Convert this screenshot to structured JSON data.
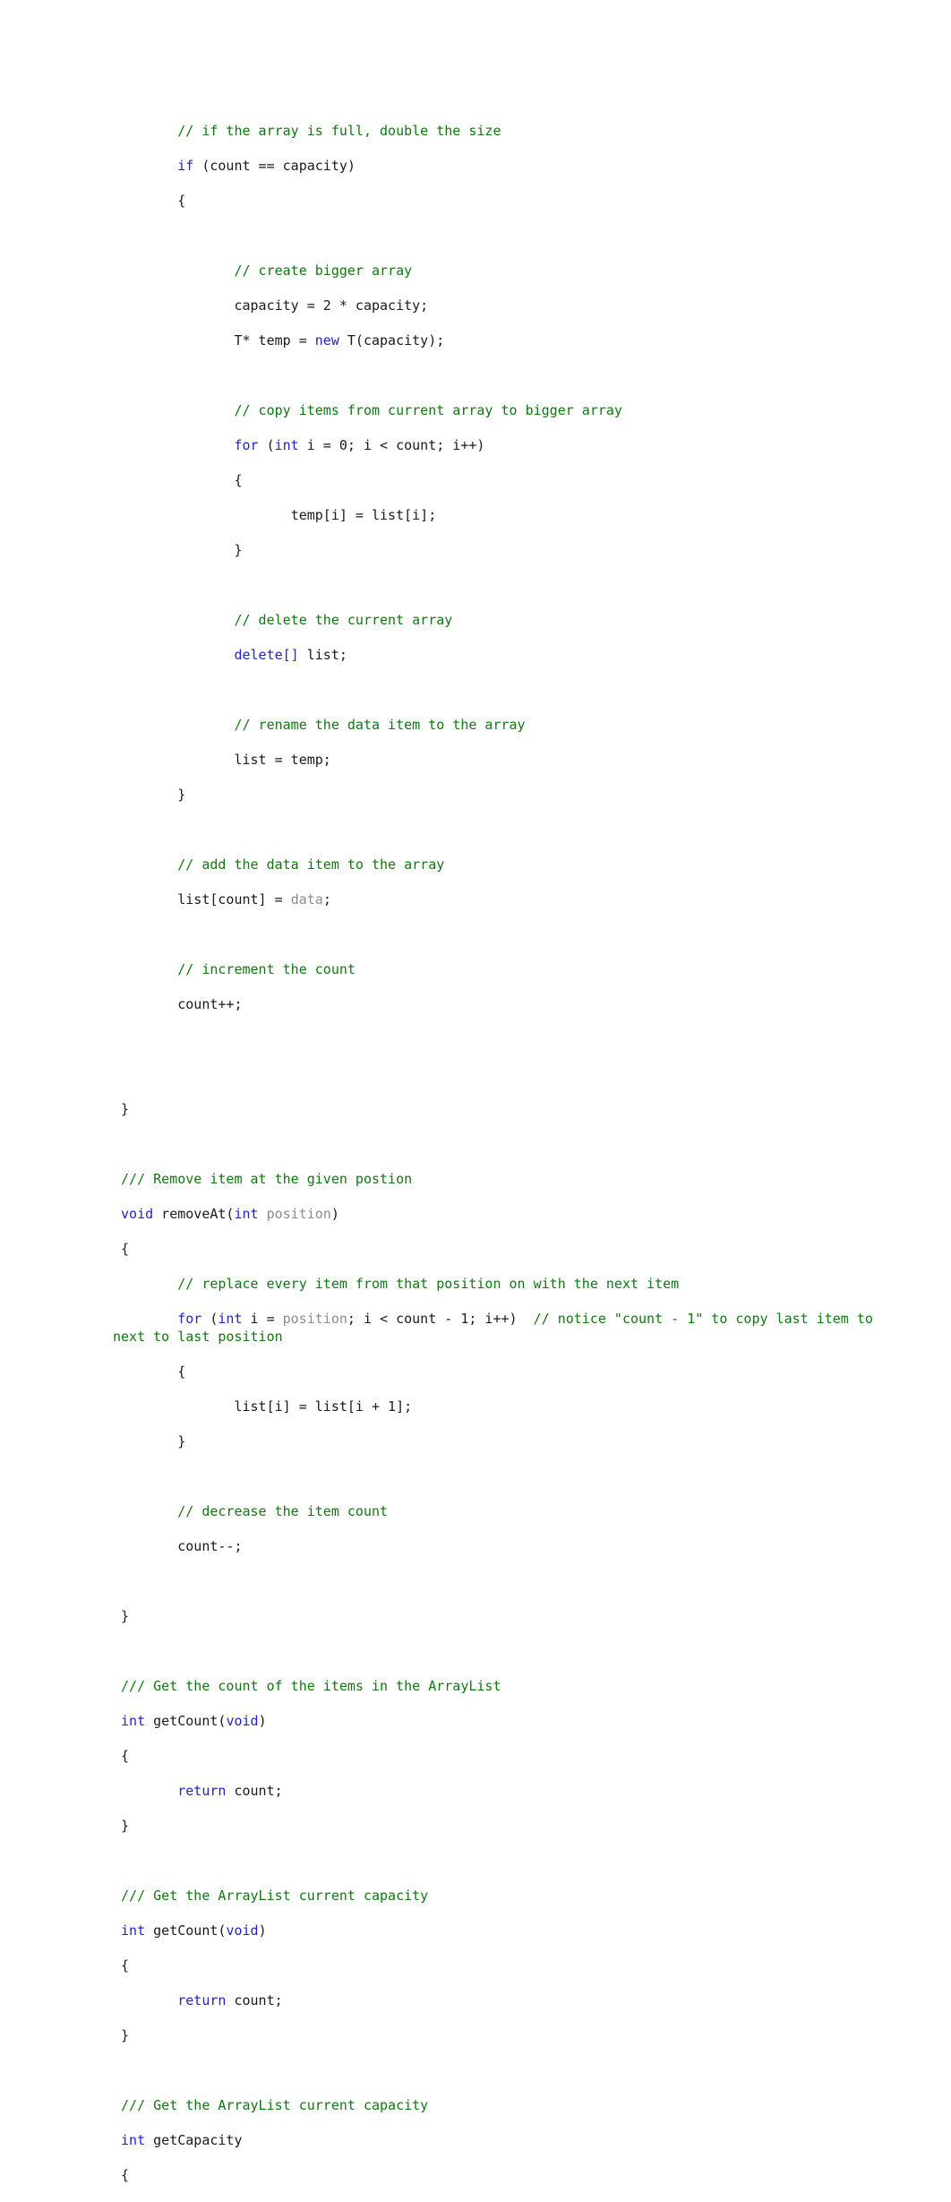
{
  "document": {
    "kind": "code-listing",
    "language": "C++",
    "page_background": "#ffffff",
    "colors": {
      "comment": "#117711",
      "keyword": "#2222cc",
      "plain": "#1a1a1a",
      "parameter": "#8c8c8c"
    }
  },
  "code": {
    "lines": [
      {
        "id": "l01",
        "indent": 8,
        "tokens": [
          {
            "t": "comment",
            "s": "// if the array is full, double the size"
          }
        ]
      },
      {
        "id": "l02",
        "indent": 8,
        "tokens": [
          {
            "t": "keyword",
            "s": "if"
          },
          {
            "t": "plain",
            "s": " (count == capacity)"
          }
        ]
      },
      {
        "id": "l03",
        "indent": 8,
        "tokens": [
          {
            "t": "plain",
            "s": "{"
          }
        ]
      },
      {
        "id": "l04",
        "indent": 8,
        "tokens": []
      },
      {
        "id": "l05",
        "indent": 15,
        "tokens": [
          {
            "t": "comment",
            "s": "// create bigger array"
          }
        ]
      },
      {
        "id": "l06",
        "indent": 15,
        "tokens": [
          {
            "t": "plain",
            "s": "capacity = 2 * capacity;"
          }
        ]
      },
      {
        "id": "l07",
        "indent": 15,
        "tokens": [
          {
            "t": "plain",
            "s": "T* temp = "
          },
          {
            "t": "keyword",
            "s": "new"
          },
          {
            "t": "plain",
            "s": " T(capacity);"
          }
        ]
      },
      {
        "id": "l08",
        "indent": 15,
        "tokens": []
      },
      {
        "id": "l09",
        "indent": 15,
        "tokens": [
          {
            "t": "comment",
            "s": "// copy items from current array to bigger array"
          }
        ]
      },
      {
        "id": "l10",
        "indent": 15,
        "tokens": [
          {
            "t": "keyword",
            "s": "for"
          },
          {
            "t": "plain",
            "s": " ("
          },
          {
            "t": "keyword",
            "s": "int"
          },
          {
            "t": "plain",
            "s": " i = 0; i < count; i++)"
          }
        ]
      },
      {
        "id": "l11",
        "indent": 15,
        "tokens": [
          {
            "t": "plain",
            "s": "{"
          }
        ]
      },
      {
        "id": "l12",
        "indent": 22,
        "tokens": [
          {
            "t": "plain",
            "s": "temp[i] = list[i];"
          }
        ]
      },
      {
        "id": "l13",
        "indent": 15,
        "tokens": [
          {
            "t": "plain",
            "s": "}"
          }
        ]
      },
      {
        "id": "l14",
        "indent": 15,
        "tokens": []
      },
      {
        "id": "l15",
        "indent": 15,
        "tokens": [
          {
            "t": "comment",
            "s": "// delete the current array"
          }
        ]
      },
      {
        "id": "l16",
        "indent": 15,
        "tokens": [
          {
            "t": "keyword",
            "s": "delete[]"
          },
          {
            "t": "plain",
            "s": " list;"
          }
        ]
      },
      {
        "id": "l17",
        "indent": 15,
        "tokens": []
      },
      {
        "id": "l18",
        "indent": 15,
        "tokens": [
          {
            "t": "comment",
            "s": "// rename the data item to the array"
          }
        ]
      },
      {
        "id": "l19",
        "indent": 15,
        "tokens": [
          {
            "t": "plain",
            "s": "list = temp;"
          }
        ]
      },
      {
        "id": "l20",
        "indent": 8,
        "tokens": [
          {
            "t": "plain",
            "s": "}"
          }
        ]
      },
      {
        "id": "l21",
        "indent": 8,
        "tokens": []
      },
      {
        "id": "l22",
        "indent": 8,
        "tokens": [
          {
            "t": "comment",
            "s": "// add the data item to the array"
          }
        ]
      },
      {
        "id": "l23",
        "indent": 8,
        "tokens": [
          {
            "t": "plain",
            "s": "list[count] = "
          },
          {
            "t": "param",
            "s": "data"
          },
          {
            "t": "plain",
            "s": ";"
          }
        ]
      },
      {
        "id": "l24",
        "indent": 8,
        "tokens": []
      },
      {
        "id": "l25",
        "indent": 8,
        "tokens": [
          {
            "t": "comment",
            "s": "// increment the count"
          }
        ]
      },
      {
        "id": "l26",
        "indent": 8,
        "tokens": [
          {
            "t": "plain",
            "s": "count++;"
          }
        ]
      },
      {
        "id": "l27",
        "indent": 0,
        "tokens": []
      },
      {
        "id": "l28",
        "indent": 0,
        "tokens": []
      },
      {
        "id": "l29",
        "indent": 1,
        "tokens": [
          {
            "t": "plain",
            "s": "}"
          }
        ]
      },
      {
        "id": "l30",
        "indent": 0,
        "tokens": []
      },
      {
        "id": "l31",
        "indent": 1,
        "tokens": [
          {
            "t": "comment",
            "s": "/// Remove item at the given postion"
          }
        ]
      },
      {
        "id": "l32",
        "indent": 1,
        "tokens": [
          {
            "t": "keyword",
            "s": "void"
          },
          {
            "t": "plain",
            "s": " removeAt("
          },
          {
            "t": "keyword",
            "s": "int"
          },
          {
            "t": "plain",
            "s": " "
          },
          {
            "t": "param",
            "s": "position"
          },
          {
            "t": "plain",
            "s": ")"
          }
        ]
      },
      {
        "id": "l33",
        "indent": 1,
        "tokens": [
          {
            "t": "plain",
            "s": "{"
          }
        ]
      },
      {
        "id": "l34",
        "indent": 8,
        "tokens": [
          {
            "t": "comment",
            "s": "// replace every item from that position on with the next item"
          }
        ]
      },
      {
        "id": "l35",
        "indent": 8,
        "tokens": [
          {
            "t": "keyword",
            "s": "for"
          },
          {
            "t": "plain",
            "s": " ("
          },
          {
            "t": "keyword",
            "s": "int"
          },
          {
            "t": "plain",
            "s": " i = "
          },
          {
            "t": "param",
            "s": "position"
          },
          {
            "t": "plain",
            "s": "; i < count - 1; i++)  "
          },
          {
            "t": "comment",
            "s": "// notice \"count - 1\" to copy last item to next to last position"
          }
        ]
      },
      {
        "id": "l36",
        "indent": 8,
        "tokens": [
          {
            "t": "plain",
            "s": "{"
          }
        ]
      },
      {
        "id": "l37",
        "indent": 15,
        "tokens": [
          {
            "t": "plain",
            "s": "list[i] = list[i + 1];"
          }
        ]
      },
      {
        "id": "l38",
        "indent": 8,
        "tokens": [
          {
            "t": "plain",
            "s": "}"
          }
        ]
      },
      {
        "id": "l39",
        "indent": 8,
        "tokens": []
      },
      {
        "id": "l40",
        "indent": 8,
        "tokens": [
          {
            "t": "comment",
            "s": "// decrease the item count"
          }
        ]
      },
      {
        "id": "l41",
        "indent": 8,
        "tokens": [
          {
            "t": "plain",
            "s": "count--;"
          }
        ]
      },
      {
        "id": "l42",
        "indent": 0,
        "tokens": []
      },
      {
        "id": "l43",
        "indent": 1,
        "tokens": [
          {
            "t": "plain",
            "s": "}"
          }
        ]
      },
      {
        "id": "l44",
        "indent": 0,
        "tokens": []
      },
      {
        "id": "l45",
        "indent": 1,
        "tokens": [
          {
            "t": "comment",
            "s": "/// Get the count of the items in the ArrayList"
          }
        ]
      },
      {
        "id": "l46",
        "indent": 1,
        "tokens": [
          {
            "t": "keyword",
            "s": "int"
          },
          {
            "t": "plain",
            "s": " getCount("
          },
          {
            "t": "keyword",
            "s": "void"
          },
          {
            "t": "plain",
            "s": ")"
          }
        ]
      },
      {
        "id": "l47",
        "indent": 1,
        "tokens": [
          {
            "t": "plain",
            "s": "{"
          }
        ]
      },
      {
        "id": "l48",
        "indent": 8,
        "tokens": [
          {
            "t": "keyword",
            "s": "return"
          },
          {
            "t": "plain",
            "s": " count;"
          }
        ]
      },
      {
        "id": "l49",
        "indent": 1,
        "tokens": [
          {
            "t": "plain",
            "s": "}"
          }
        ]
      },
      {
        "id": "l50",
        "indent": 0,
        "tokens": []
      },
      {
        "id": "l51",
        "indent": 1,
        "tokens": [
          {
            "t": "comment",
            "s": "/// Get the ArrayList current capacity"
          }
        ]
      },
      {
        "id": "l52",
        "indent": 1,
        "tokens": [
          {
            "t": "keyword",
            "s": "int"
          },
          {
            "t": "plain",
            "s": " getCount("
          },
          {
            "t": "keyword",
            "s": "void"
          },
          {
            "t": "plain",
            "s": ")"
          }
        ]
      },
      {
        "id": "l53",
        "indent": 1,
        "tokens": [
          {
            "t": "plain",
            "s": "{"
          }
        ]
      },
      {
        "id": "l54",
        "indent": 8,
        "tokens": [
          {
            "t": "keyword",
            "s": "return"
          },
          {
            "t": "plain",
            "s": " count;"
          }
        ]
      },
      {
        "id": "l55",
        "indent": 1,
        "tokens": [
          {
            "t": "plain",
            "s": "}"
          }
        ]
      },
      {
        "id": "l56",
        "indent": 0,
        "tokens": []
      },
      {
        "id": "l57",
        "indent": 1,
        "tokens": [
          {
            "t": "comment",
            "s": "/// Get the ArrayList current capacity"
          }
        ]
      },
      {
        "id": "l58",
        "indent": 1,
        "tokens": [
          {
            "t": "keyword",
            "s": "int"
          },
          {
            "t": "plain",
            "s": " getCapacity"
          }
        ]
      },
      {
        "id": "l59",
        "indent": 1,
        "tokens": [
          {
            "t": "plain",
            "s": "{"
          }
        ]
      }
    ]
  }
}
